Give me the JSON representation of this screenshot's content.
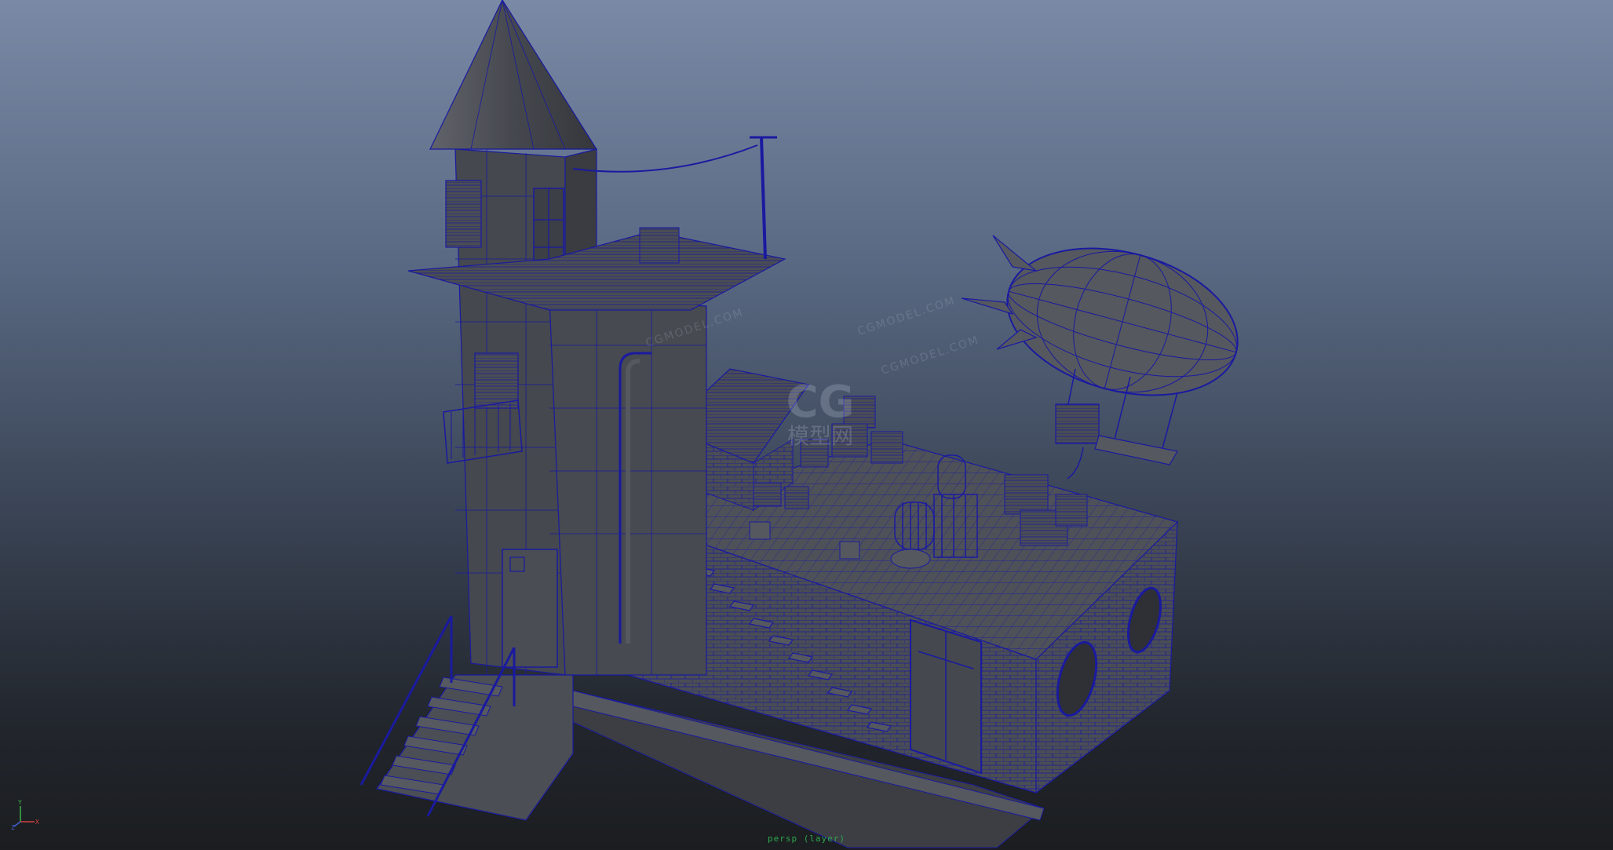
{
  "viewport": {
    "camera_label": "persp (layer)",
    "background_top": "#7a8aa6",
    "background_bottom": "#1b1d20",
    "wire_color": "#1a1aa0",
    "mesh_color": "#4c4f55"
  },
  "axis": {
    "x": "X",
    "y": "Y",
    "z": "Z"
  },
  "watermark": {
    "text": "CGMODEL.COM",
    "logo_main": "CG",
    "logo_sub": "模型网"
  }
}
